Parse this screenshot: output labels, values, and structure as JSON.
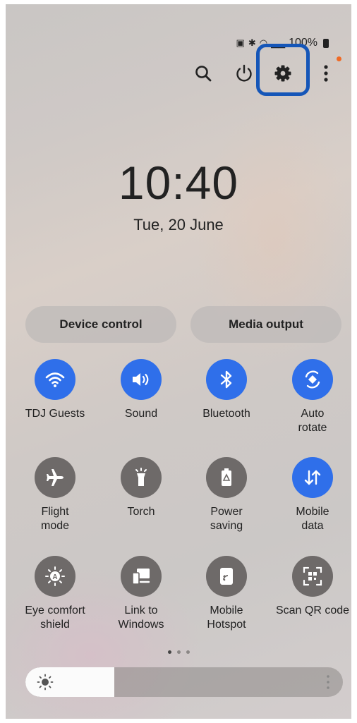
{
  "status": {
    "battery": "100%"
  },
  "header": {
    "icons": [
      "search-icon",
      "power-icon",
      "settings-icon",
      "more-options-icon"
    ],
    "accent": "#f06a25",
    "highlight_color": "#1556b8"
  },
  "clock": {
    "time": "10:40",
    "date": "Tue, 20 June"
  },
  "buttons": {
    "device_control": "Device control",
    "media_output": "Media output"
  },
  "tiles": [
    {
      "label": "TDJ Guests",
      "icon": "wifi-icon",
      "on": true
    },
    {
      "label": "Sound",
      "icon": "sound-icon",
      "on": true
    },
    {
      "label": "Bluetooth",
      "icon": "bluetooth-icon",
      "on": true
    },
    {
      "label": "Auto\nrotate",
      "icon": "auto-rotate-icon",
      "on": true
    },
    {
      "label": "Flight\nmode",
      "icon": "airplane-icon",
      "on": false
    },
    {
      "label": "Torch",
      "icon": "torch-icon",
      "on": false
    },
    {
      "label": "Power\nsaving",
      "icon": "power-saving-icon",
      "on": false
    },
    {
      "label": "Mobile\ndata",
      "icon": "mobile-data-icon",
      "on": true
    },
    {
      "label": "Eye comfort\nshield",
      "icon": "eye-comfort-icon",
      "on": false
    },
    {
      "label": "Link to\nWindows",
      "icon": "link-to-windows-icon",
      "on": false
    },
    {
      "label": "Mobile\nHotspot",
      "icon": "hotspot-icon",
      "on": false
    },
    {
      "label": "Scan QR code",
      "icon": "qr-code-icon",
      "on": false
    }
  ],
  "pagination": {
    "pages": 3,
    "current": 1
  },
  "brightness": {
    "level": 0.28
  },
  "colors": {
    "tile_on": "#2f6fea",
    "tile_off": "#6e6a69"
  }
}
